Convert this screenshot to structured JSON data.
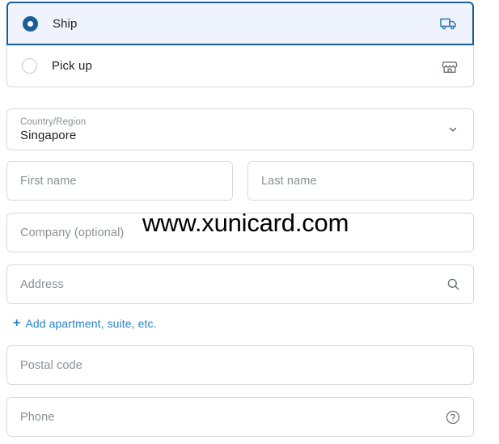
{
  "delivery": {
    "options": [
      {
        "id": "ship",
        "label": "Ship",
        "selected": true,
        "icon": "delivery-truck-icon"
      },
      {
        "id": "pickup",
        "label": "Pick up",
        "selected": false,
        "icon": "storefront-icon"
      }
    ]
  },
  "country": {
    "label": "Country/Region",
    "value": "Singapore",
    "chevron_icon": "chevron-down-icon"
  },
  "fields": {
    "first_name_placeholder": "First name",
    "last_name_placeholder": "Last name",
    "company_placeholder": "Company (optional)",
    "address_placeholder": "Address",
    "address_icon": "search-icon",
    "postal_code_placeholder": "Postal code",
    "phone_placeholder": "Phone",
    "phone_icon": "help-circle-icon"
  },
  "add_apartment": {
    "plus": "+",
    "label": "Add apartment, suite, etc."
  },
  "watermark": {
    "text": "www.xunicard.com"
  },
  "colors": {
    "accent_blue": "#1a6096",
    "link_blue": "#2683c8",
    "selected_row_bg": "#eff3fb",
    "border_grey": "#d9d9d9",
    "placeholder_grey": "#8b8f94",
    "icon_grey": "#6b7075",
    "text_dark": "#1f1f1f"
  }
}
